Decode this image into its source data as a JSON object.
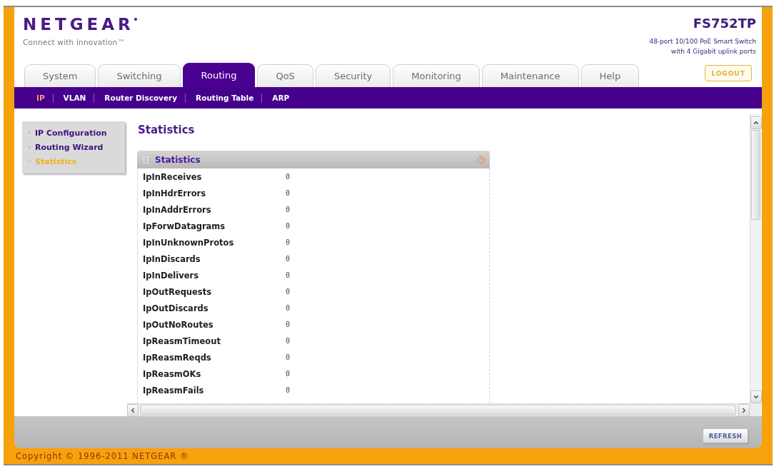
{
  "header": {
    "logo": "NETGEAR",
    "tagline": "Connect with innovation™",
    "model": "FS752TP",
    "description": [
      "48-port 10/100 PoE Smart Switch",
      "with 4 Gigabit uplink ports"
    ],
    "logout": "LOGOUT"
  },
  "tabs": [
    {
      "label": "System",
      "selected": false
    },
    {
      "label": "Switching",
      "selected": false
    },
    {
      "label": "Routing",
      "selected": true
    },
    {
      "label": "QoS",
      "selected": false
    },
    {
      "label": "Security",
      "selected": false
    },
    {
      "label": "Monitoring",
      "selected": false
    },
    {
      "label": "Maintenance",
      "selected": false
    },
    {
      "label": "Help",
      "selected": false
    }
  ],
  "subnav": [
    {
      "label": "IP",
      "selected": true
    },
    {
      "label": "VLAN",
      "selected": false
    },
    {
      "label": "Router Discovery",
      "selected": false
    },
    {
      "label": "Routing Table",
      "selected": false
    },
    {
      "label": "ARP",
      "selected": false
    }
  ],
  "sidebar": {
    "items": [
      {
        "label": "IP Configuration",
        "selected": false
      },
      {
        "label": "Routing Wizard",
        "selected": false
      },
      {
        "label": "Statistics",
        "selected": true
      }
    ]
  },
  "page_title": "Statistics",
  "panel": {
    "title": "Statistics",
    "rows": [
      {
        "name": "IpInReceives",
        "value": "0"
      },
      {
        "name": "IpInHdrErrors",
        "value": "0"
      },
      {
        "name": "IpInAddrErrors",
        "value": "0"
      },
      {
        "name": "IpForwDatagrams",
        "value": "0"
      },
      {
        "name": "IpInUnknownProtos",
        "value": "0"
      },
      {
        "name": "IpInDiscards",
        "value": "0"
      },
      {
        "name": "IpInDelivers",
        "value": "0"
      },
      {
        "name": "IpOutRequests",
        "value": "0"
      },
      {
        "name": "IpOutDiscards",
        "value": "0"
      },
      {
        "name": "IpOutNoRoutes",
        "value": "0"
      },
      {
        "name": "IpReasmTimeout",
        "value": "0"
      },
      {
        "name": "IpReasmReqds",
        "value": "0"
      },
      {
        "name": "IpReasmOKs",
        "value": "0"
      },
      {
        "name": "IpReasmFails",
        "value": "0"
      }
    ]
  },
  "footer": {
    "buttons": [
      "REFRESH"
    ]
  },
  "copyright": "Copyright © 1996-2011 NETGEAR ®"
}
